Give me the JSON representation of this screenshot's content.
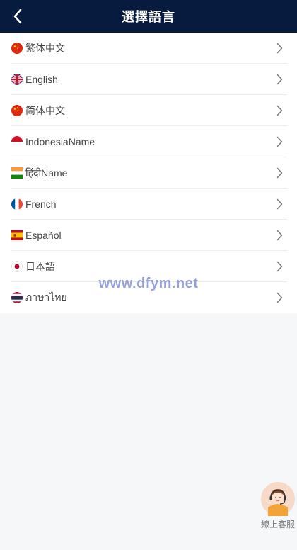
{
  "header": {
    "title": "選擇語言"
  },
  "languages": [
    {
      "label": "繁体中文",
      "flag": "china-flag-icon"
    },
    {
      "label": "English",
      "flag": "uk-flag-icon"
    },
    {
      "label": "简体中文",
      "flag": "china-flag-icon"
    },
    {
      "label": "IndonesiaName",
      "flag": "indonesia-flag-icon"
    },
    {
      "label": "हिंदीName",
      "flag": "india-flag-icon"
    },
    {
      "label": "French",
      "flag": "france-flag-icon"
    },
    {
      "label": "Español",
      "flag": "spain-flag-icon"
    },
    {
      "label": "日本語",
      "flag": "japan-flag-icon"
    },
    {
      "label": "ภาษาไทย",
      "flag": "thailand-flag-icon"
    }
  ],
  "watermark": "www.dfym.net",
  "service": {
    "label": "線上客服",
    "icon": "customer-service-avatar-icon"
  },
  "colors": {
    "header_bg": "#071b3f",
    "page_bg": "#f6f7f9",
    "watermark": "#8f97d6"
  }
}
